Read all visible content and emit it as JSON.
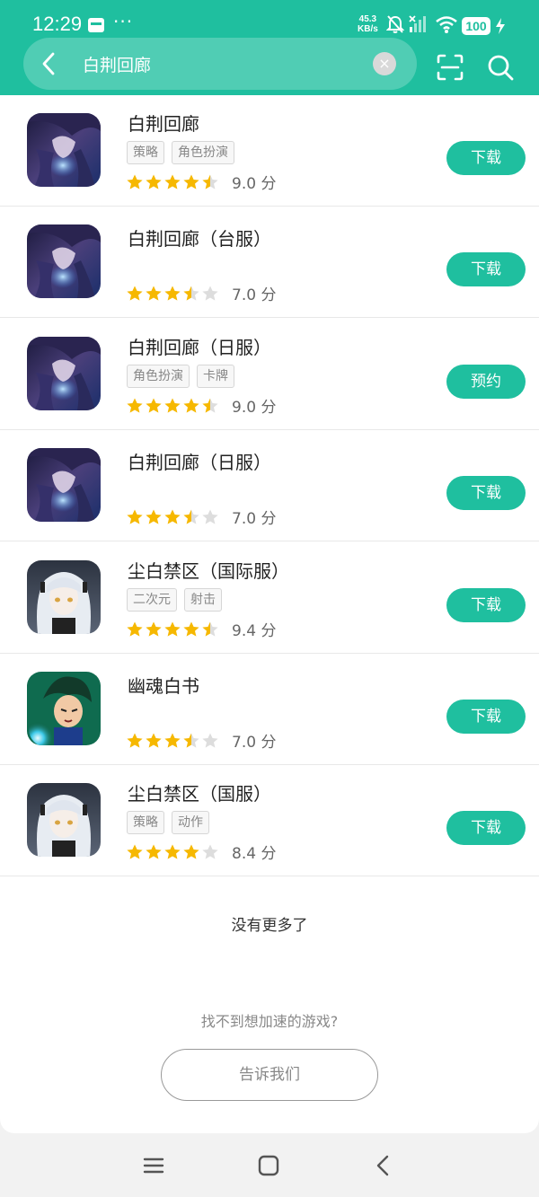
{
  "status_bar": {
    "time": "12:29",
    "more_label": "···",
    "net_speed_value": "45.3",
    "net_speed_unit": "KB/s",
    "battery": "100"
  },
  "search": {
    "query": "白荆回廊",
    "clear_label": "×"
  },
  "colors": {
    "accent": "#1fbf9f",
    "star": "#f6b800",
    "star_empty": "#dddddd"
  },
  "results": [
    {
      "name": "白荆回廊",
      "tags": [
        "策略",
        "角色扮演"
      ],
      "stars": 4.5,
      "score": "9.0 分",
      "action": "下载",
      "icon": "anime-girl-dark"
    },
    {
      "name": "白荆回廊（台服）",
      "tags": [],
      "stars": 3.5,
      "score": "7.0 分",
      "action": "下载",
      "icon": "anime-girl-dark"
    },
    {
      "name": "白荆回廊（日服）",
      "tags": [
        "角色扮演",
        "卡牌"
      ],
      "stars": 4.5,
      "score": "9.0 分",
      "action": "预约",
      "icon": "anime-girl-dark"
    },
    {
      "name": "白荆回廊（日服）",
      "tags": [],
      "stars": 3.5,
      "score": "7.0 分",
      "action": "下载",
      "icon": "anime-girl-dark"
    },
    {
      "name": "尘白禁区（国际服）",
      "tags": [
        "二次元",
        "射击"
      ],
      "stars": 4.5,
      "score": "9.4 分",
      "action": "下载",
      "icon": "anime-girl-silver"
    },
    {
      "name": "幽魂白书",
      "tags": [],
      "stars": 3.5,
      "score": "7.0 分",
      "action": "下载",
      "icon": "anime-boy-green"
    },
    {
      "name": "尘白禁区（国服）",
      "tags": [
        "策略",
        "动作"
      ],
      "stars": 4,
      "score": "8.4 分",
      "action": "下载",
      "icon": "anime-girl-silver"
    }
  ],
  "footer": {
    "no_more": "没有更多了",
    "cant_find": "找不到想加速的游戏?",
    "tell_us": "告诉我们"
  },
  "nav": {
    "icons": [
      "menu-icon",
      "home-icon",
      "back-icon"
    ]
  }
}
